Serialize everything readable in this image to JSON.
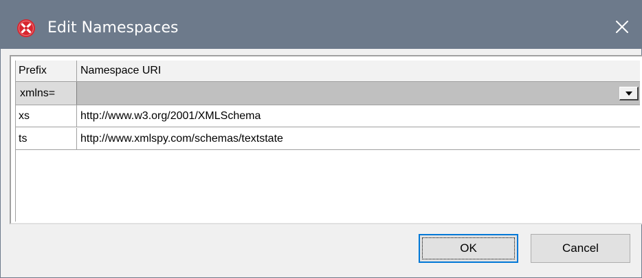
{
  "window": {
    "title": "Edit Namespaces",
    "icon": "app-logo-icon",
    "close_icon": "close-icon",
    "titlebar_color": "#6d7a8b"
  },
  "grid": {
    "columns": [
      "Prefix",
      "Namespace URI"
    ],
    "default_row": {
      "prefix": "xmlns=",
      "uri": "",
      "dropdown_icon": "dropdown-arrow-icon"
    },
    "rows": [
      {
        "prefix": "xs",
        "uri": "http://www.w3.org/2001/XMLSchema"
      },
      {
        "prefix": "ts",
        "uri": "http://www.xmlspy.com/schemas/textstate"
      }
    ]
  },
  "buttons": {
    "ok_label": "OK",
    "cancel_label": "Cancel",
    "focus_color": "#0078d7"
  }
}
